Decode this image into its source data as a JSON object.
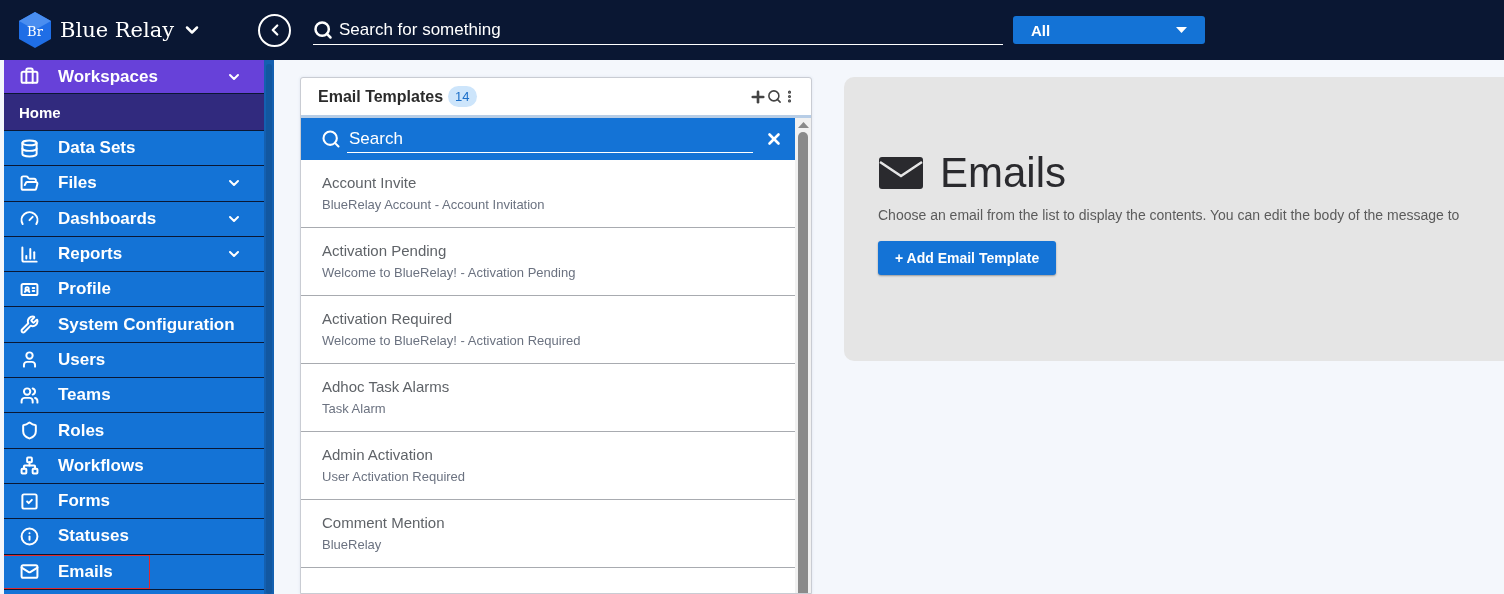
{
  "header": {
    "brand": "Blue Relay",
    "logo_text": "Br",
    "search": {
      "placeholder": "Search for something"
    },
    "filter": {
      "value": "All"
    }
  },
  "sidebar": {
    "items": [
      {
        "label": "Workspaces",
        "kind": "group",
        "expandable": true,
        "children": [
          {
            "label": "Home",
            "selected": true
          }
        ]
      },
      {
        "label": "Data Sets",
        "kind": "item",
        "expandable": false,
        "outlined": false
      },
      {
        "label": "Files",
        "kind": "item",
        "expandable": true,
        "outlined": false
      },
      {
        "label": "Dashboards",
        "kind": "item",
        "expandable": true,
        "outlined": false
      },
      {
        "label": "Reports",
        "kind": "item",
        "expandable": true,
        "outlined": false
      },
      {
        "label": "Profile",
        "kind": "item",
        "expandable": false,
        "outlined": false
      },
      {
        "label": "System Configuration",
        "kind": "item",
        "expandable": false,
        "outlined": false
      },
      {
        "label": "Users",
        "kind": "item",
        "expandable": false,
        "outlined": false
      },
      {
        "label": "Teams",
        "kind": "item",
        "expandable": false,
        "outlined": false
      },
      {
        "label": "Roles",
        "kind": "item",
        "expandable": false,
        "outlined": false
      },
      {
        "label": "Workflows",
        "kind": "item",
        "expandable": false,
        "outlined": false
      },
      {
        "label": "Forms",
        "kind": "item",
        "expandable": false,
        "outlined": false
      },
      {
        "label": "Statuses",
        "kind": "item",
        "expandable": false,
        "outlined": false
      },
      {
        "label": "Emails",
        "kind": "item",
        "expandable": false,
        "outlined": true
      }
    ]
  },
  "templates": {
    "title": "Email Templates",
    "count": "14",
    "search": {
      "placeholder": "Search"
    },
    "items": [
      {
        "name": "Account Invite",
        "subject": "BlueRelay Account - Account Invitation"
      },
      {
        "name": "Activation Pending",
        "subject": "Welcome to BlueRelay! - Activation Pending"
      },
      {
        "name": "Activation Required",
        "subject": "Welcome to BlueRelay! - Activation Required"
      },
      {
        "name": "Adhoc Task Alarms",
        "subject": "Task Alarm"
      },
      {
        "name": "Admin Activation",
        "subject": "User Activation Required"
      },
      {
        "name": "Comment Mention",
        "subject": "BlueRelay"
      }
    ]
  },
  "detail": {
    "title": "Emails",
    "description": "Choose an email from the list to display the contents. You can edit the body of the message to",
    "button": "+ Add Email Template"
  }
}
